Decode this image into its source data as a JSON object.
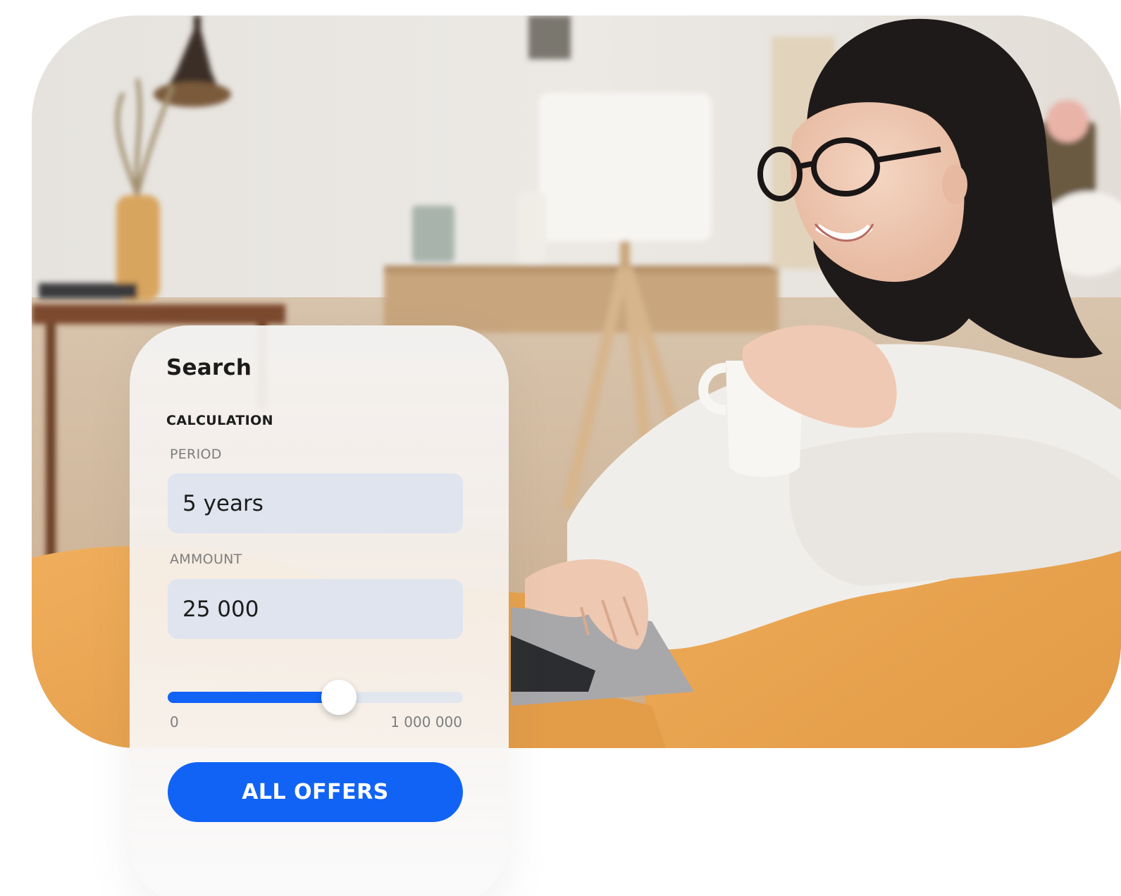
{
  "search_card": {
    "title": "Search",
    "section": "CALCULATION",
    "period": {
      "label": "PERIOD",
      "value": "5 years"
    },
    "amount": {
      "label": "AMMOUNT",
      "value": "25 000"
    },
    "slider": {
      "min_label": "0",
      "max_label": "1 000 000",
      "fill_fraction": 0.58
    },
    "cta_label": "ALL OFFERS"
  },
  "colors": {
    "accent": "#1163f5",
    "field_bg": "#dfe4ef",
    "beanbag": "#e8a04e"
  },
  "photo": {
    "subject": "smiling woman with glasses holding a mug, using a laptop on an orange beanbag"
  }
}
